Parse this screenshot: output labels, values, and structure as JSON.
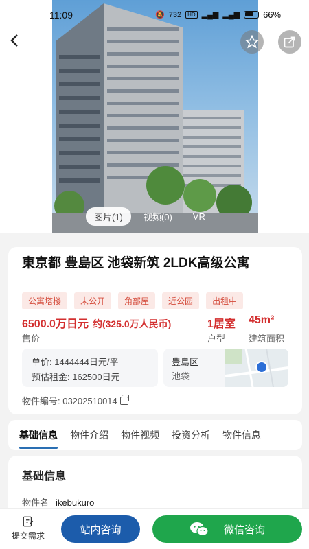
{
  "status_bar": {
    "time": "11:09",
    "net_speed": "732",
    "battery": "66%"
  },
  "media_tabs": [
    {
      "label": "图片(1)"
    },
    {
      "label": "视频(0)"
    },
    {
      "label": "VR"
    }
  ],
  "listing": {
    "title": "東京都 豊島区 池袋新筑 2LDK高级公寓",
    "tags": [
      "公寓塔楼",
      "未公开",
      "角部屋",
      "近公园",
      "出租中"
    ],
    "price": "6500.0万日元",
    "price_rmb": "约(325.0万人民币)",
    "price_label": "售价",
    "layout": "1居室",
    "layout_label": "户型",
    "area": "45m²",
    "area_label": "建筑面积",
    "unit_price": "单价: 1444444日元/平",
    "est_rent": "预估租金: 162500日元",
    "ward": "豊島区",
    "district": "池袋",
    "property_no": "物件编号: 03202510014"
  },
  "detail_tabs": [
    "基础信息",
    "物件介绍",
    "物件视频",
    "投资分析",
    "物件信息"
  ],
  "basic_info": {
    "title": "基础信息",
    "name_label": "物件名",
    "name_value": "ikebukuro"
  },
  "bottom_bar": {
    "submit_label": "提交需求",
    "consult_label": "站内咨询",
    "wechat_label": "微信咨询"
  },
  "colors": {
    "accent_red": "#d32f2f",
    "primary_blue": "#1c5cab",
    "wechat_green": "#1fa64c"
  }
}
